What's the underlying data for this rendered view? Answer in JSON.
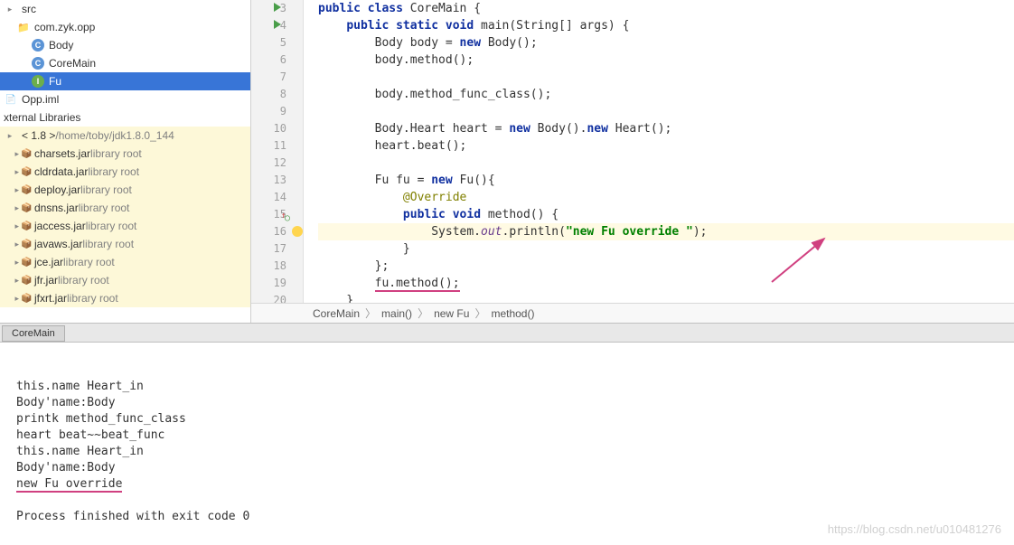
{
  "tree": {
    "src": "src",
    "package": "com.zyk.opp",
    "classes": [
      {
        "name": "Body",
        "icon": "C",
        "cls": "c-blue",
        "data_name": "tree-class-body"
      },
      {
        "name": "CoreMain",
        "icon": "C",
        "cls": "c-blue",
        "data_name": "tree-class-coremain"
      },
      {
        "name": "Fu",
        "icon": "I",
        "cls": "c-green",
        "data_name": "tree-class-fu"
      }
    ],
    "iml": "Opp.iml",
    "ext_header": "xternal Libraries",
    "jdk_label": "< 1.8 >",
    "jdk_path": "/home/toby/jdk1.8.0_144",
    "jars": [
      "charsets.jar",
      "cldrdata.jar",
      "deploy.jar",
      "dnsns.jar",
      "jaccess.jar",
      "javaws.jar",
      "jce.jar",
      "jfr.jar",
      "jfxrt.jar"
    ],
    "lib_root": "library root"
  },
  "editor": {
    "lines": [
      {
        "n": 3,
        "runner": true,
        "html": "<span class='kw'>public class</span> CoreMain {"
      },
      {
        "n": 4,
        "runner": true,
        "html": "    <span class='kw'>public static void</span> main(String[] args) {"
      },
      {
        "n": 5,
        "html": "        Body body = <span class='kw'>new</span> Body();"
      },
      {
        "n": 6,
        "html": "        body.method();"
      },
      {
        "n": 7,
        "html": ""
      },
      {
        "n": 8,
        "html": "        body.method_func_class();"
      },
      {
        "n": 9,
        "html": ""
      },
      {
        "n": 10,
        "html": "        Body.Heart heart = <span class='kw'>new</span> Body().<span class='kw'>new</span> Heart();"
      },
      {
        "n": 11,
        "html": "        heart.beat();"
      },
      {
        "n": 12,
        "html": ""
      },
      {
        "n": 13,
        "html": "        Fu fu = <span class='kw'>new</span> Fu(){"
      },
      {
        "n": 14,
        "html": "            <span class='an'>@Override</span>"
      },
      {
        "n": 15,
        "override": true,
        "html": "            <span class='kw'>public void</span> method() {"
      },
      {
        "n": 16,
        "bulb": true,
        "hl": true,
        "html": "                System.<span class='fld'>out</span>.println(<span class='str'>\"new Fu override \"</span>);"
      },
      {
        "n": 17,
        "html": "            }"
      },
      {
        "n": 18,
        "html": "        };"
      },
      {
        "n": 19,
        "html": "        <span class='underline-red'>fu.method();</span>"
      },
      {
        "n": 20,
        "html": "    }"
      }
    ]
  },
  "breadcrumb": [
    "CoreMain",
    "main()",
    "new Fu",
    "method()"
  ],
  "tab": "CoreMain",
  "console": {
    "lines": [
      "this.name Heart_in",
      "Body'name:Body",
      "printk method_func_class",
      "heart beat~~beat_func",
      "this.name Heart_in",
      "Body'name:Body",
      "new Fu override ",
      "",
      "Process finished with exit code 0"
    ],
    "hl_line_idx": 6
  },
  "watermark": "https://blog.csdn.net/u010481276"
}
